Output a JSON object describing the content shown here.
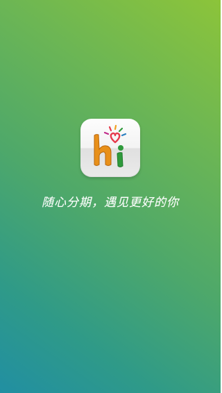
{
  "splash": {
    "logo_icon": "hi-heart-logo-icon",
    "tagline": "随心分期，遇见更好的你"
  },
  "colors": {
    "gradient_top_right": "#8cc43a",
    "gradient_bottom_left": "#218fa2",
    "logo_h": "#e8901a",
    "logo_i": "#2f9a3c",
    "logo_heart": "#e63a4c"
  }
}
